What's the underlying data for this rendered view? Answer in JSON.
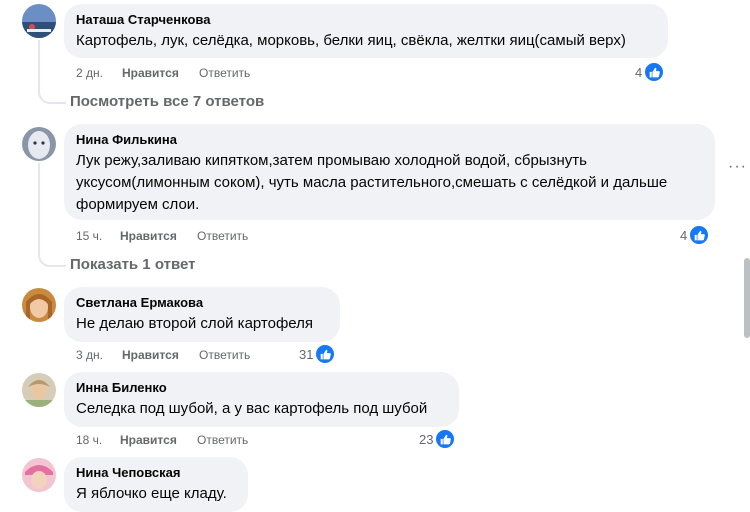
{
  "comments": [
    {
      "author": "Наташа Старченкова",
      "text": "Картофель, лук, селёдка, морковь, белки яиц, свёкла, желтки яиц(самый верх)",
      "time": "2 дн.",
      "like_label": "Нравится",
      "reply_label": "Ответить",
      "reactions": "4"
    },
    {
      "author": "Нина Филькина",
      "text_lines": [
        "Лук режу,заливаю кипятком,затем промываю холодной водой, сбрызнуть",
        "уксусом(лимонным соком), чуть масла растительного,смешать с селёдкой и дальше",
        "формируем слои."
      ],
      "time": "15 ч.",
      "like_label": "Нравится",
      "reply_label": "Ответить",
      "reactions": "4"
    },
    {
      "author": "Светлана Ермакова",
      "text": "Не делаю второй слой картофеля",
      "time": "3 дн.",
      "like_label": "Нравится",
      "reply_label": "Ответить",
      "reactions": "31"
    },
    {
      "author": "Инна Биленко",
      "text": "Селедка под шубой, а у вас картофель под шубой",
      "time": "18 ч.",
      "like_label": "Нравится",
      "reply_label": "Ответить",
      "reactions": "23"
    },
    {
      "author": "Нина Чеповская",
      "text": "Я яблочко еще кладу."
    }
  ],
  "view_replies_1": "Посмотреть все 7 ответов",
  "view_replies_2": "Показать 1 ответ",
  "more_options": "···",
  "colors": {
    "like_blue": "#1877f2",
    "bubble": "#f0f2f5",
    "meta": "#65676b"
  }
}
